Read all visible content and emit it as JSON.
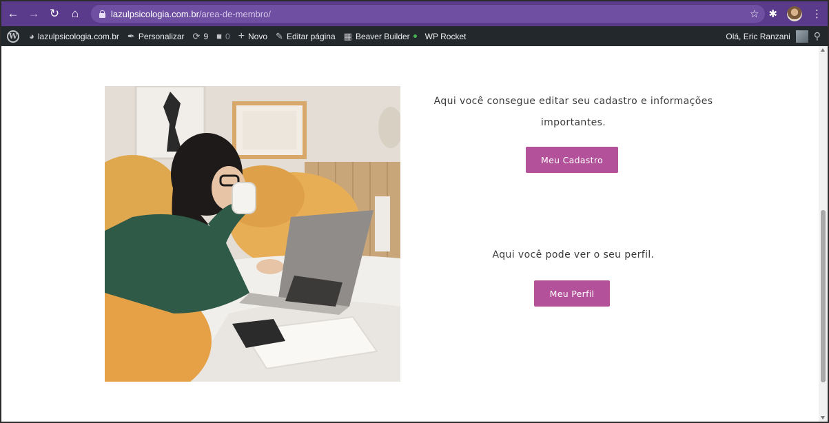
{
  "browser": {
    "url_host": "lazulpsicologia.com.br",
    "url_path": "/area-de-membro/",
    "accent_color": "#5a3a8a"
  },
  "adminbar": {
    "site_name": "lazulpsicologia.com.br",
    "customize": "Personalizar",
    "updates_count": "9",
    "comments_count": "0",
    "new_label": "Novo",
    "edit_page": "Editar página",
    "beaver_builder": "Beaver Builder",
    "wp_rocket": "WP Rocket",
    "greeting": "Olá, Eric Ranzani"
  },
  "main": {
    "cadastro_text": "Aqui você consegue editar seu cadastro e informações importantes.",
    "cadastro_button": "Meu Cadastro",
    "perfil_text": "Aqui você pode ver o seu perfil.",
    "perfil_button": "Meu Perfil",
    "button_color": "#b3519a"
  }
}
